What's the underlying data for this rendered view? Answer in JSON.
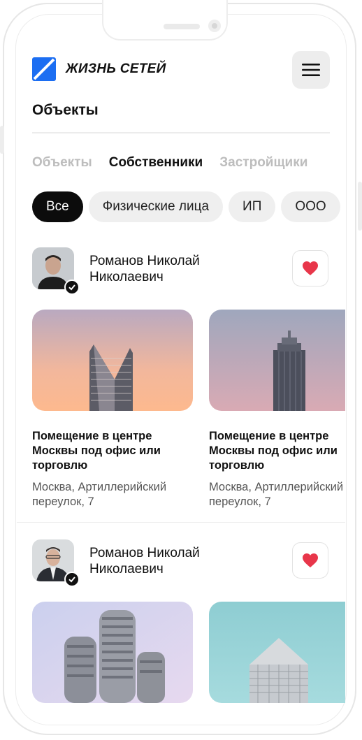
{
  "header": {
    "brand": "ЖИЗНЬ СЕТЕЙ",
    "title": "Объекты"
  },
  "tabs": [
    {
      "label": "Объекты",
      "active": false
    },
    {
      "label": "Собственники",
      "active": true
    },
    {
      "label": "Застройщики",
      "active": false
    }
  ],
  "filters": [
    {
      "label": "Все",
      "active": true
    },
    {
      "label": "Физические лица",
      "active": false
    },
    {
      "label": "ИП",
      "active": false
    },
    {
      "label": "ООО",
      "active": false
    }
  ],
  "owners": [
    {
      "name": "Романов Николай Николаевич",
      "listings": [
        {
          "title": "Помещение в центре Москвы под офис или торговлю",
          "address": "Москва, Артиллерийский переулок, 7"
        },
        {
          "title": "Помещение в центре Москвы под офис или торговлю",
          "address": "Москва, Артиллерийский переулок, 7"
        }
      ]
    },
    {
      "name": "Романов Николай Николаевич",
      "listings": [
        {
          "title": "",
          "address": ""
        },
        {
          "title": "",
          "address": ""
        }
      ]
    }
  ],
  "colors": {
    "accent": "#1c6ef2",
    "heart": "#e8364a",
    "chip_active": "#0c0c0c"
  },
  "icons": {
    "menu": "hamburger-icon",
    "favorite": "heart-icon",
    "verified": "check-badge-icon",
    "logo": "brand-logo-icon"
  }
}
